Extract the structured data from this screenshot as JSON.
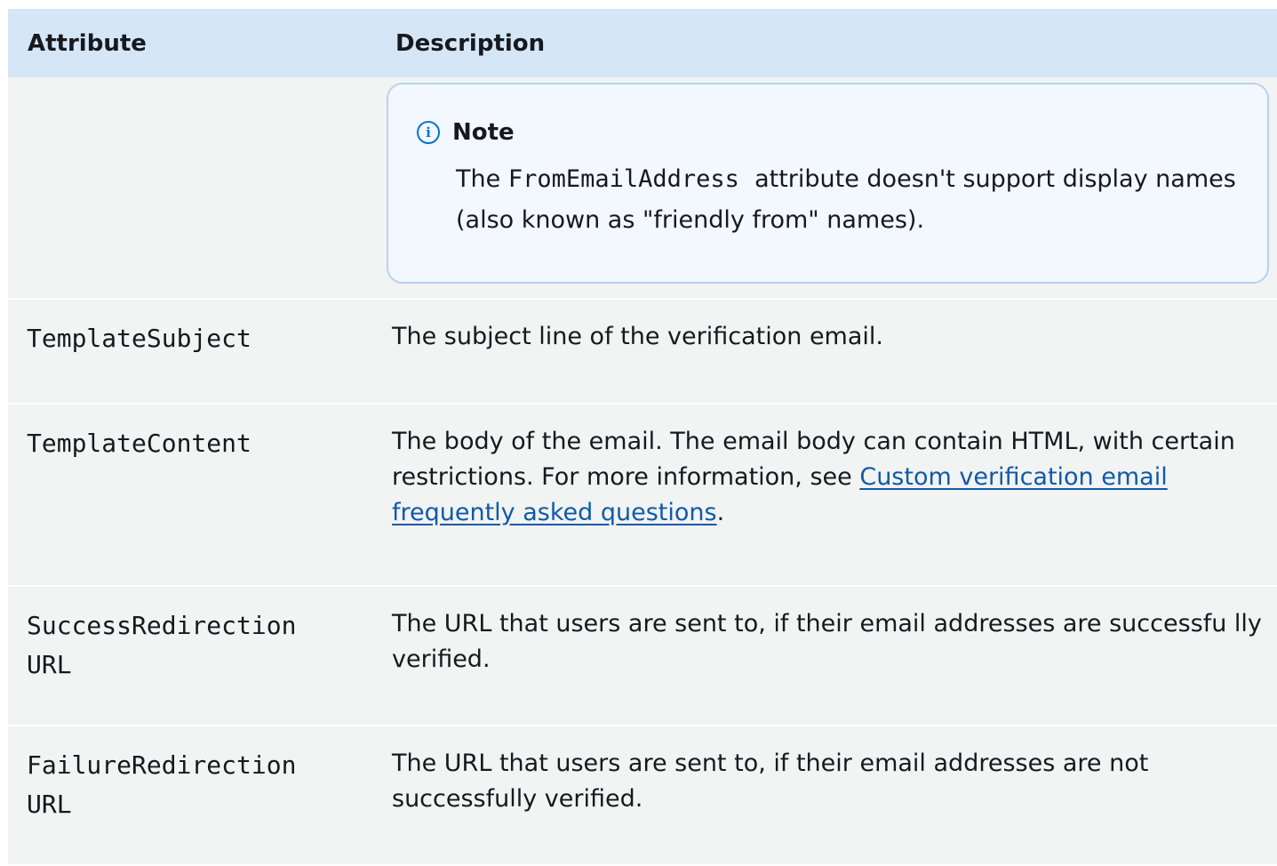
{
  "table": {
    "headers": {
      "attribute": "Attribute",
      "description": "Description"
    },
    "note": {
      "title": "Note",
      "text_before": "The ",
      "code": "FromEmailAddress",
      "text_after": "  attribute doesn't support display names (also known as \"friendly from\" names)."
    },
    "rows": [
      {
        "attribute": "TemplateSubject",
        "description": "The subject line of the verification email."
      },
      {
        "attribute": "TemplateContent",
        "description_before": "The body of the email. The email body can contain HTML, with certain restrictions. For more information, see ",
        "link_text": "Custom verification email frequently asked questions",
        "description_after": "."
      },
      {
        "attribute_line1": "SuccessRedirection",
        "attribute_line2": "URL",
        "description": "The URL that users are sent to, if their email addresses are successfu lly verified."
      },
      {
        "attribute_line1": "FailureRedirection",
        "attribute_line2": "URL",
        "description": "The URL that users are sent to, if their email addresses are not successfully verified."
      }
    ]
  },
  "colors": {
    "header_bg": "#d5e6f7",
    "row_bg": "#f2f3f3",
    "note_border": "#b5d3f1",
    "link": "#0f5aa8",
    "info_icon": "#0972d3"
  },
  "icons": {
    "note_icon": "info-icon"
  }
}
